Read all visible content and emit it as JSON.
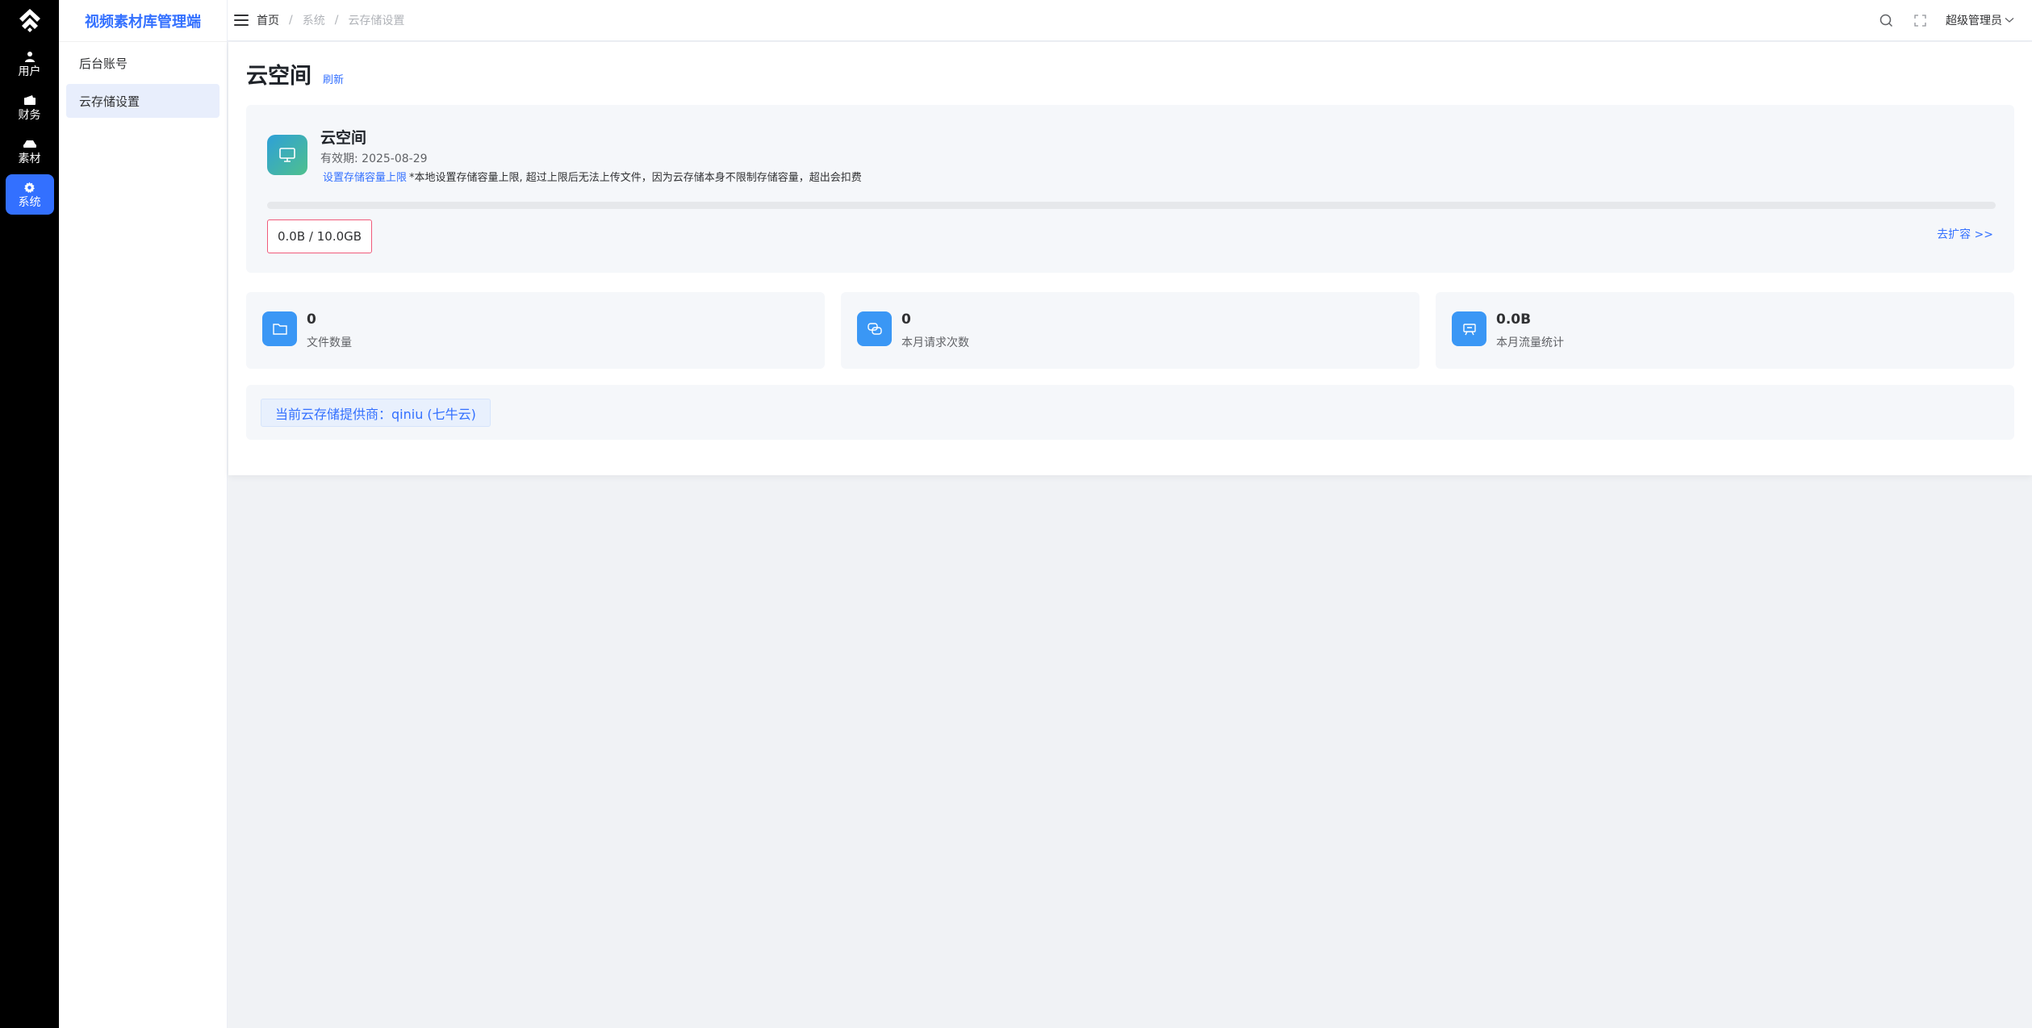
{
  "rail": {
    "items": [
      {
        "label": "用户",
        "icon": "user-icon"
      },
      {
        "label": "财务",
        "icon": "wallet-icon"
      },
      {
        "label": "素材",
        "icon": "materials-icon"
      },
      {
        "label": "系统",
        "icon": "gear-icon"
      }
    ],
    "active_index": 3
  },
  "subnav": {
    "title": "视频素材库管理端",
    "items": [
      {
        "label": "后台账号"
      },
      {
        "label": "云存储设置"
      }
    ],
    "active_index": 1
  },
  "header": {
    "breadcrumb": [
      "首页",
      "系统",
      "云存储设置"
    ],
    "separator": "/",
    "user": "超级管理员"
  },
  "page": {
    "title": "云空间",
    "refresh_label": "刷新"
  },
  "space": {
    "name": "云空间",
    "expiry": "有效期: 2025-08-29",
    "set_limit_link": "设置存储容量上限",
    "note": "*本地设置存储容量上限, 超过上限后无法上传文件，因为云存储本身不限制存储容量，超出会扣费",
    "usage_text": "0.0B / 10.0GB",
    "usage_fraction": 0,
    "expand_link": "去扩容 >>"
  },
  "stats": [
    {
      "value": "0",
      "label": "文件数量",
      "icon": "folder-icon"
    },
    {
      "value": "0",
      "label": "本月请求次数",
      "icon": "requests-icon"
    },
    {
      "value": "0.0B",
      "label": "本月流量统计",
      "icon": "traffic-icon"
    }
  ],
  "provider": {
    "text": "当前云存储提供商：qiniu (七牛云)"
  },
  "colors": {
    "accent": "#3370ff",
    "rail_bg": "#000000",
    "stat_icon_bg": "#3a97f5",
    "usage_border": "#f05a7a"
  }
}
